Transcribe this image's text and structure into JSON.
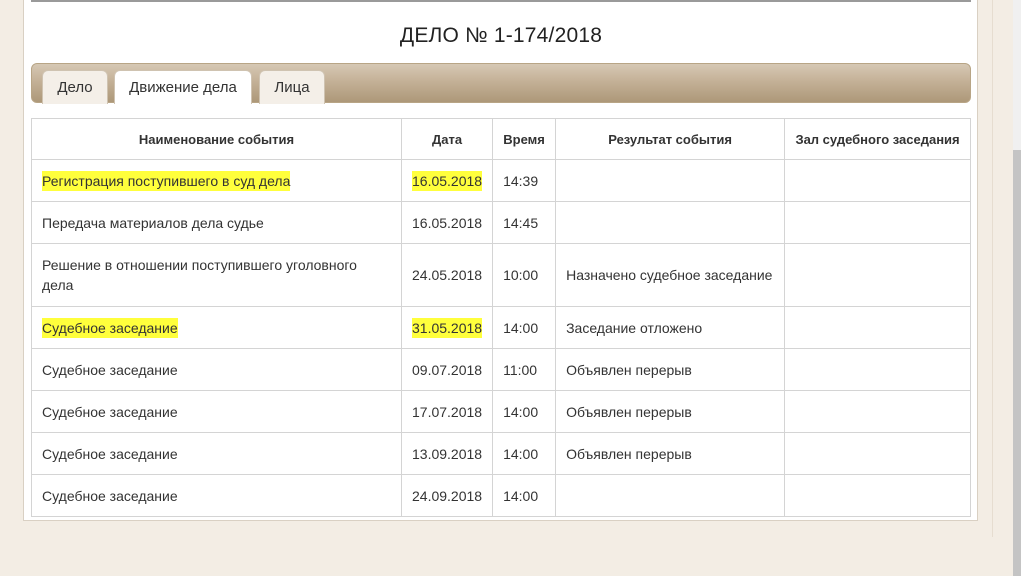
{
  "case": {
    "title": "ДЕЛО № 1-174/2018"
  },
  "tabs": [
    {
      "label": "Дело",
      "active": false
    },
    {
      "label": "Движение дела",
      "active": true
    },
    {
      "label": "Лица",
      "active": false
    }
  ],
  "table": {
    "headers": [
      "Наименование события",
      "Дата",
      "Время",
      "Результат события",
      "Зал судебного заседания"
    ],
    "rows": [
      {
        "name": "Регистрация поступившего в суд дела",
        "date": "16.05.2018",
        "time": "14:39",
        "result": "",
        "hall": "",
        "highlighted": true
      },
      {
        "name": "Передача материалов дела судье",
        "date": "16.05.2018",
        "time": "14:45",
        "result": "",
        "hall": "",
        "highlighted": false
      },
      {
        "name": "Решение в отношении поступившего уголовного дела",
        "date": "24.05.2018",
        "time": "10:00",
        "result": "Назначено судебное заседание",
        "hall": "",
        "highlighted": false
      },
      {
        "name": "Судебное заседание",
        "date": "31.05.2018",
        "time": "14:00",
        "result": "Заседание отложено",
        "hall": "",
        "highlighted": true
      },
      {
        "name": "Судебное заседание",
        "date": "09.07.2018",
        "time": "11:00",
        "result": "Объявлен перерыв",
        "hall": "",
        "highlighted": false
      },
      {
        "name": "Судебное заседание",
        "date": "17.07.2018",
        "time": "14:00",
        "result": "Объявлен перерыв",
        "hall": "",
        "highlighted": false
      },
      {
        "name": "Судебное заседание",
        "date": "13.09.2018",
        "time": "14:00",
        "result": "Объявлен перерыв",
        "hall": "",
        "highlighted": false
      },
      {
        "name": "Судебное заседание",
        "date": "24.09.2018",
        "time": "14:00",
        "result": "",
        "hall": "",
        "highlighted": false
      }
    ]
  },
  "colors": {
    "highlight": "#ffff3c",
    "tab_bar": "#c4b197",
    "page_bg": "#f3ede4"
  }
}
